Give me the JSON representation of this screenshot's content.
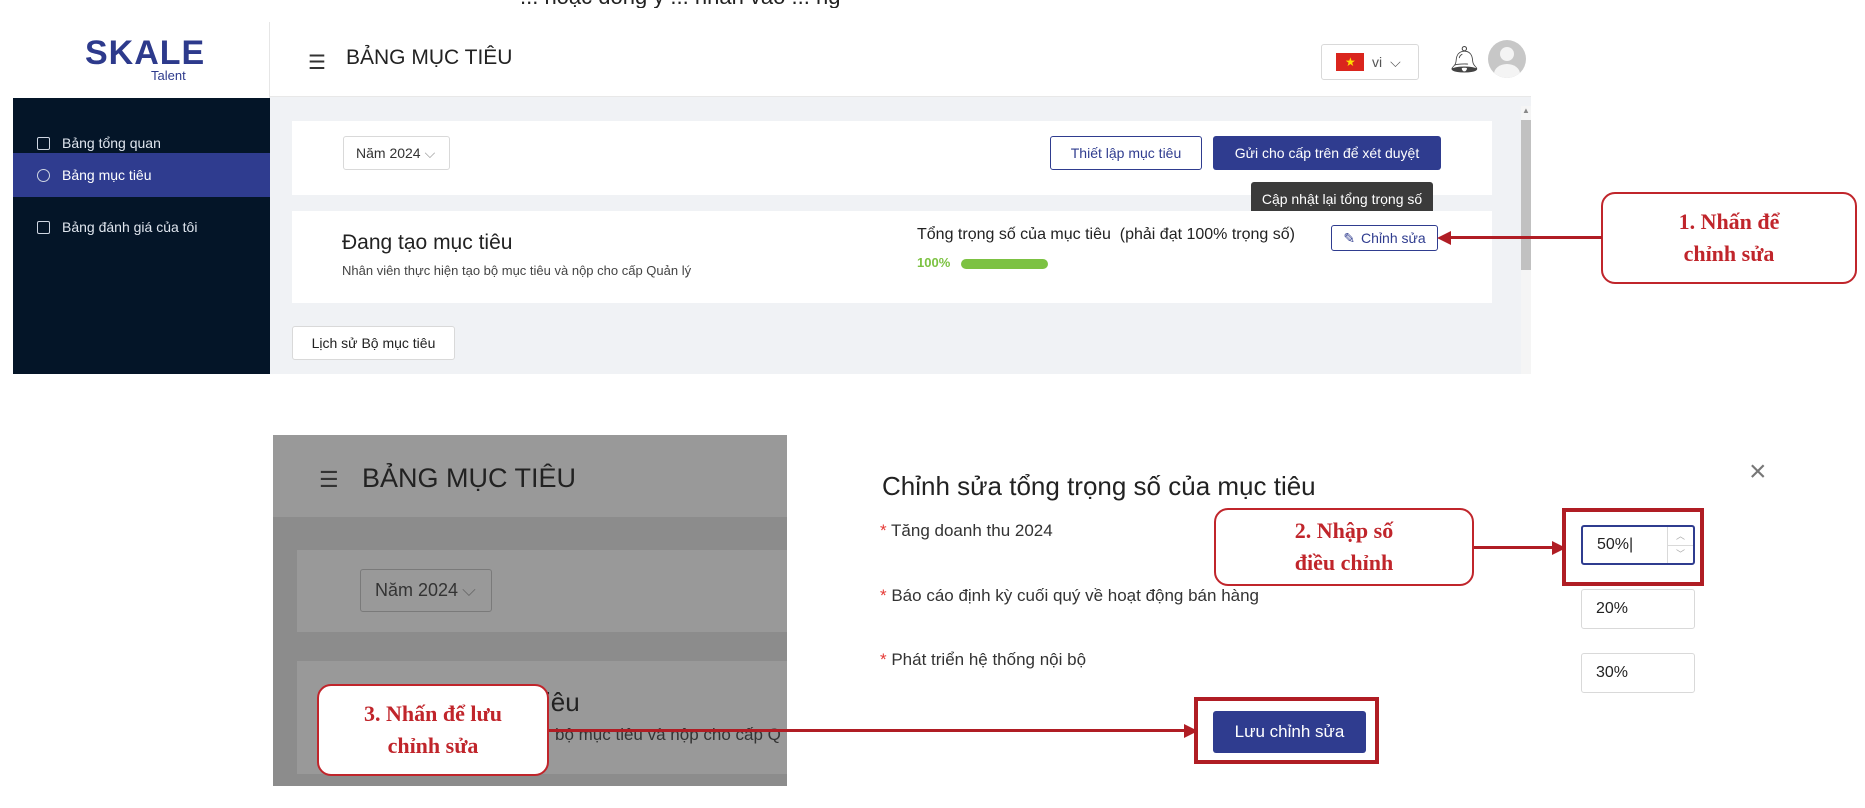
{
  "top_cut_text": "... hoặc đồng ý ... nhấn vào ... ng",
  "shot1": {
    "logo": {
      "main": "SKALE",
      "sub": "Talent"
    },
    "sidebar": {
      "items": [
        {
          "label": "Bảng tổng quan",
          "icon": "dashboard-icon"
        },
        {
          "label": "Bảng mục tiêu",
          "icon": "gauge-icon",
          "active": true
        },
        {
          "label": "Bảng đánh giá của tôi",
          "icon": "table-icon"
        }
      ]
    },
    "header": {
      "title": "BẢNG MỤC TIÊU",
      "language": "vi",
      "hamburger": "☰"
    },
    "filter": {
      "year": "Năm 2024",
      "setup_button": "Thiết lập mục tiêu",
      "submit_button": "Gửi cho cấp trên để xét duyệt"
    },
    "tooltip": "Cập nhật lại tổng trọng số",
    "status_card": {
      "title": "Đang tạo mục tiêu",
      "description": "Nhân viên thực hiện tạo bộ mục tiêu và nộp cho cấp Quản lý",
      "weight_label": "Tổng trọng số của mục tiêu  (phải đạt 100% trọng số)",
      "edit_button": "Chỉnh sửa",
      "progress_text": "100%",
      "progress_value": 1.0
    },
    "history_button": "Lịch sử Bộ mục tiêu"
  },
  "callouts": {
    "step1": "1. Nhấn để\nchỉnh sửa",
    "step2": "2. Nhập số\nđiều chỉnh",
    "step3": "3. Nhấn để lưu\nchỉnh sửa"
  },
  "shot2": {
    "bg": {
      "title": "BẢNG MỤC TIÊU",
      "year": "Năm 2024",
      "card_title_fragment": "iêu",
      "card_desc_fragment": "bộ mục tiêu và nộp cho cấp Q"
    },
    "modal": {
      "title": "Chỉnh sửa tổng trọng số của mục tiêu",
      "close": "×",
      "rows": [
        {
          "label": "Tăng doanh thu 2024",
          "value": "50%"
        },
        {
          "label": "Báo cáo định kỳ cuối quý về hoạt động bán hàng",
          "value": "20%"
        },
        {
          "label": "Phát triển hệ thống nội bộ",
          "value": "30%"
        }
      ],
      "save_button": "Lưu chỉnh sửa"
    }
  },
  "colors": {
    "primary": "#2f3c8f",
    "sidebar": "#041528",
    "accent_red": "#c0252b",
    "progress": "#7cc242"
  }
}
